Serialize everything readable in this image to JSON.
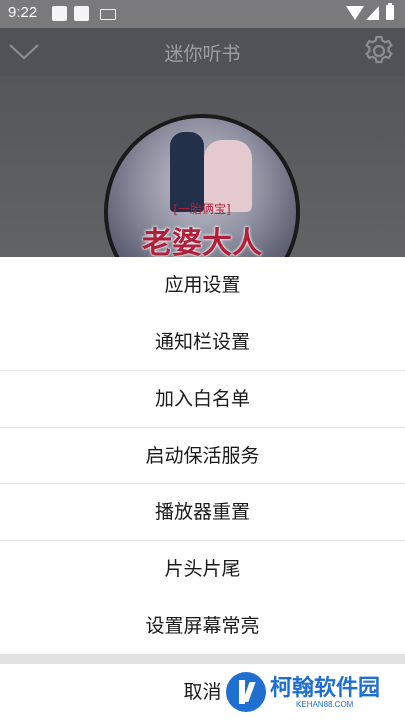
{
  "status_bar": {
    "time": "9:22",
    "icons": [
      "notification-icon",
      "notification-icon",
      "keyboard-icon",
      "wifi-icon",
      "signal-icon",
      "battery-icon"
    ]
  },
  "header": {
    "title": "迷你听书",
    "left_icon": "chevron-down-icon",
    "right_icon": "gear-icon"
  },
  "cover": {
    "subtitle": "[一胎俩宝]",
    "title": "老婆大人"
  },
  "menu": {
    "items": [
      {
        "label": "应用设置"
      },
      {
        "label": "通知栏设置"
      },
      {
        "label": "加入白名单"
      },
      {
        "label": "启动保活服务"
      },
      {
        "label": "播放器重置"
      },
      {
        "label": "片头片尾"
      },
      {
        "label": "设置屏幕常亮"
      }
    ],
    "cancel_label": "取消"
  },
  "watermark": {
    "text": "柯翰软件园",
    "sub": "KEHAN88.COM"
  },
  "colors": {
    "header_bg": "#4f5256",
    "sheet_bg": "#ffffff",
    "watermark": "#1f6fd1"
  }
}
